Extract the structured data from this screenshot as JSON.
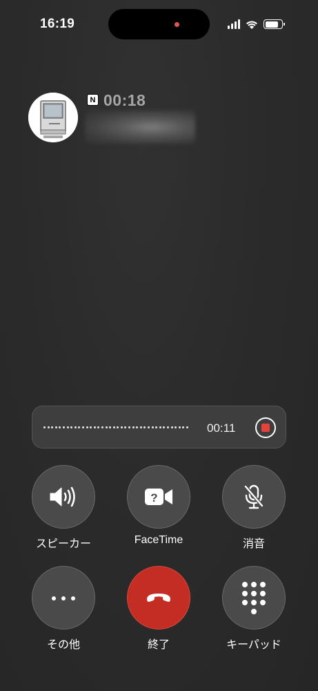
{
  "status_bar": {
    "time": "16:19"
  },
  "caller": {
    "app_badge": "N",
    "call_duration": "00:18"
  },
  "recording": {
    "elapsed": "00:11"
  },
  "controls": {
    "speaker_label": "スピーカー",
    "facetime_label": "FaceTime",
    "mute_label": "消音",
    "more_label": "その他",
    "end_label": "終了",
    "keypad_label": "キーパッド"
  },
  "colors": {
    "end_call": "#c42d24",
    "record_stop": "#e5423a",
    "island_indicator": "#e0574f"
  }
}
